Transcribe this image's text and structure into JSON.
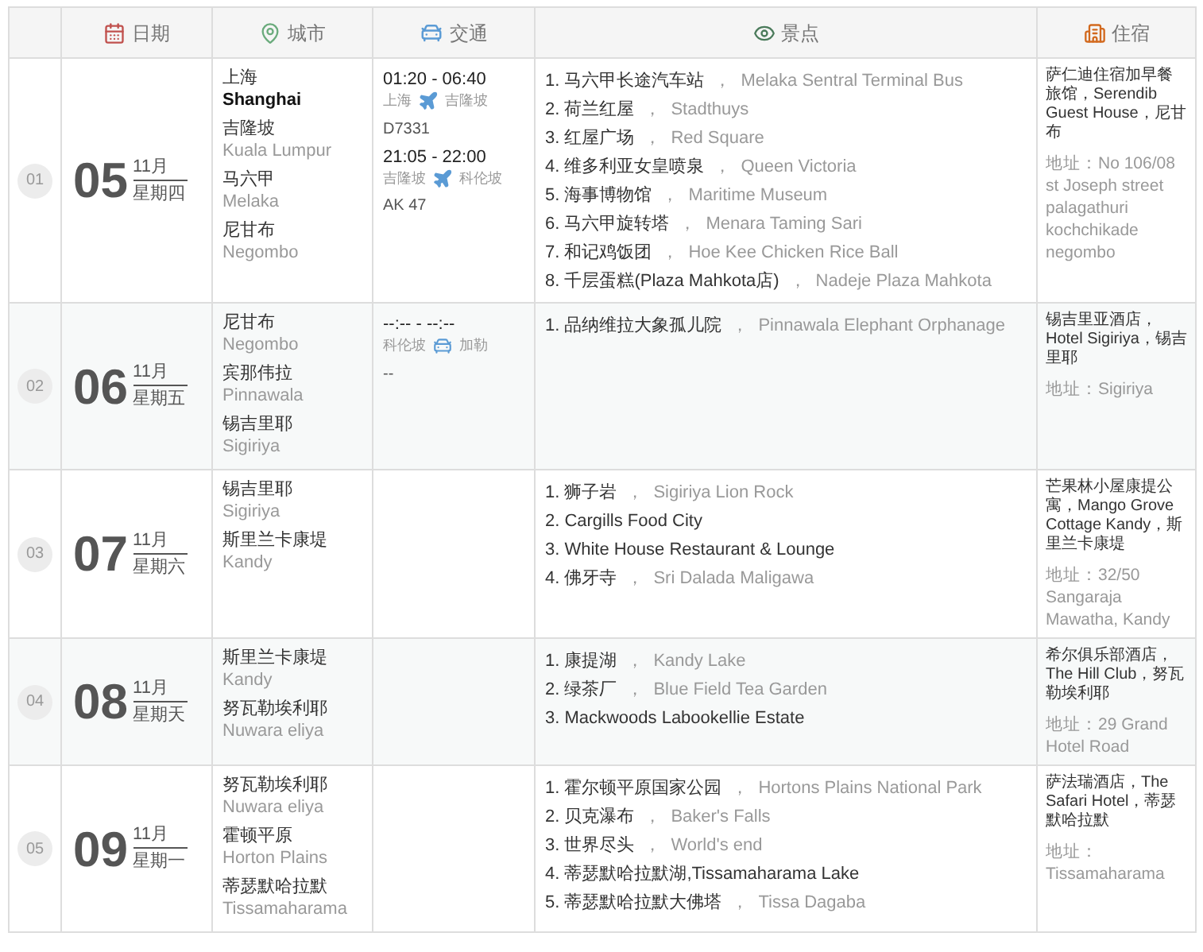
{
  "header": [
    {
      "kind": "index"
    },
    {
      "kind": "date",
      "label": "日期"
    },
    {
      "kind": "city",
      "label": "城市"
    },
    {
      "kind": "transport",
      "label": "交通"
    },
    {
      "kind": "sights",
      "label": "景点"
    },
    {
      "kind": "hotel",
      "label": "住宿"
    }
  ],
  "days": [
    {
      "index": "01",
      "day": "05",
      "month": "11月",
      "weekday": "星期四",
      "cities": [
        {
          "cn": "上海",
          "en": "Shanghai",
          "emphasized": true
        },
        {
          "cn": "吉隆坡",
          "en": "Kuala Lumpur",
          "emphasized": false
        },
        {
          "cn": "马六甲",
          "en": "Melaka",
          "emphasized": false
        },
        {
          "cn": "尼甘布",
          "en": "Negombo",
          "emphasized": false
        }
      ],
      "transport": [
        {
          "time": "01:20 - 06:40",
          "from": "上海",
          "kind": "plane",
          "to": "吉隆坡",
          "code": "D7331"
        },
        {
          "time": "21:05 - 22:00",
          "from": "吉隆坡",
          "kind": "plane",
          "to": "科伦坡",
          "code": "AK 47"
        }
      ],
      "sights": [
        {
          "num": "1.",
          "name": "马六甲长途汽车站",
          "sep": "，",
          "en": "Melaka Sentral Terminal Bus"
        },
        {
          "num": "2.",
          "name": "荷兰红屋",
          "sep": "，",
          "en": "Stadthuys"
        },
        {
          "num": "3.",
          "name": "红屋广场",
          "sep": "，",
          "en": "Red Square"
        },
        {
          "num": "4.",
          "name": "维多利亚女皇喷泉",
          "sep": "，",
          "en": "Queen Victoria"
        },
        {
          "num": "5.",
          "name": "海事博物馆",
          "sep": "，",
          "en": "Maritime Museum"
        },
        {
          "num": "6.",
          "name": "马六甲旋转塔",
          "sep": "，",
          "en": "Menara Taming Sari"
        },
        {
          "num": "7.",
          "name": "和记鸡饭团",
          "sep": "，",
          "en": "Hoe Kee Chicken Rice Ball"
        },
        {
          "num": "8.",
          "name": "千层蛋糕(Plaza Mahkota店)",
          "sep": "，",
          "en": "Nadeje Plaza Mahkota"
        }
      ],
      "hotel": {
        "name": "萨仁迪住宿加早餐旅馆，Serendib Guest House，尼甘布",
        "address": "地址：No 106/08 st Joseph street palagathuri kochchikade negombo"
      }
    },
    {
      "index": "02",
      "day": "06",
      "month": "11月",
      "weekday": "星期五",
      "cities": [
        {
          "cn": "尼甘布",
          "en": "Negombo",
          "emphasized": false
        },
        {
          "cn": "宾那伟拉",
          "en": "Pinnawala",
          "emphasized": false
        },
        {
          "cn": "锡吉里耶",
          "en": "Sigiriya",
          "emphasized": false
        }
      ],
      "transport": [
        {
          "time": "--:-- - --:--",
          "from": "科伦坡",
          "kind": "car",
          "to": "加勒",
          "code": "--"
        }
      ],
      "sights": [
        {
          "num": "1.",
          "name": "品纳维拉大象孤儿院",
          "sep": "，",
          "en": "Pinnawala Elephant Orphanage"
        }
      ],
      "hotel": {
        "name": "锡吉里亚酒店，Hotel Sigiriya，锡吉里耶",
        "address": "地址：Sigiriya"
      }
    },
    {
      "index": "03",
      "day": "07",
      "month": "11月",
      "weekday": "星期六",
      "cities": [
        {
          "cn": "锡吉里耶",
          "en": "Sigiriya",
          "emphasized": false
        },
        {
          "cn": "斯里兰卡康堤",
          "en": "Kandy",
          "emphasized": false
        }
      ],
      "sights": [
        {
          "num": "1.",
          "name": "狮子岩",
          "sep": "，",
          "en": "Sigiriya Lion Rock"
        },
        {
          "num": "2.",
          "name": "Cargills Food City"
        },
        {
          "num": "3.",
          "name": "White House Restaurant & Lounge"
        },
        {
          "num": "4.",
          "name": "佛牙寺",
          "sep": "，",
          "en": "Sri Dalada Maligawa"
        }
      ],
      "hotel": {
        "name": "芒果林小屋康提公寓，Mango Grove Cottage Kandy，斯里兰卡康堤",
        "address": "地址：32/50 Sangaraja Mawatha, Kandy"
      }
    },
    {
      "index": "04",
      "day": "08",
      "month": "11月",
      "weekday": "星期天",
      "cities": [
        {
          "cn": "斯里兰卡康堤",
          "en": "Kandy",
          "emphasized": false
        },
        {
          "cn": "努瓦勒埃利耶",
          "en": "Nuwara eliya",
          "emphasized": false
        }
      ],
      "sights": [
        {
          "num": "1.",
          "name": "康提湖",
          "sep": "，",
          "en": "Kandy Lake"
        },
        {
          "num": "2.",
          "name": "绿茶厂",
          "sep": "，",
          "en": "Blue Field Tea Garden"
        },
        {
          "num": "3.",
          "name": "Mackwoods Labookellie Estate"
        }
      ],
      "hotel": {
        "name": "希尔俱乐部酒店，The Hill Club，努瓦勒埃利耶",
        "address": "地址：29 Grand Hotel Road"
      }
    },
    {
      "index": "05",
      "day": "09",
      "month": "11月",
      "weekday": "星期一",
      "cities": [
        {
          "cn": "努瓦勒埃利耶",
          "en": "Nuwara eliya",
          "emphasized": false
        },
        {
          "cn": "霍顿平原",
          "en": "Horton Plains",
          "emphasized": false
        },
        {
          "cn": "蒂瑟默哈拉默",
          "en": "Tissamaharama",
          "emphasized": false
        }
      ],
      "sights": [
        {
          "num": "1.",
          "name": "霍尔顿平原国家公园",
          "sep": "，",
          "en": "Hortons Plains National Park"
        },
        {
          "num": "2.",
          "name": "贝克瀑布",
          "sep": "，",
          "en": "Baker's Falls"
        },
        {
          "num": "3.",
          "name": "世界尽头",
          "sep": "，",
          "en": "World's end"
        },
        {
          "num": "4.",
          "name": "蒂瑟默哈拉默湖,Tissamaharama Lake"
        },
        {
          "num": "5.",
          "name": "蒂瑟默哈拉默大佛塔",
          "sep": "，",
          "en": "Tissa Dagaba"
        }
      ],
      "hotel": {
        "name": "萨法瑞酒店，The Safari Hotel，蒂瑟默哈拉默",
        "address": "地址：Tissamaharama"
      }
    }
  ]
}
